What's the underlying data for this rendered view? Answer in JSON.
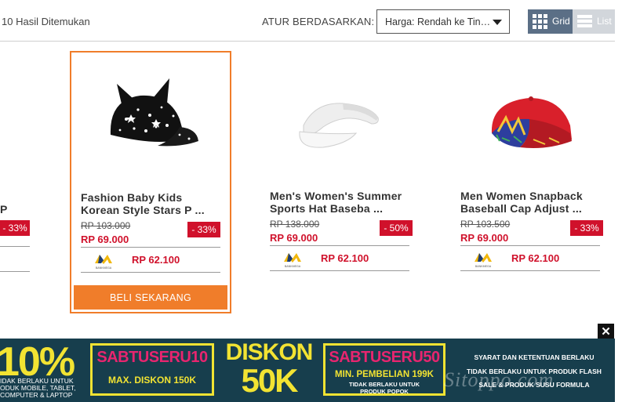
{
  "toolbar": {
    "results_text": "10 Hasil Ditemukan",
    "sort_label": "ATUR BERDASARKAN:",
    "sort_value": "Harga: Rendah ke Tin…",
    "grid_label": "Grid",
    "list_label": "List"
  },
  "partial_card": {
    "title": "P ...",
    "discount": "- 33%"
  },
  "products": [
    {
      "title_line1": "Fashion Baby Kids",
      "title_line2": "Korean Style Stars P ...",
      "old_price": "RP 103.000",
      "price": "RP 69.000",
      "discount": "- 33%",
      "bank_name": "BANKMEGA",
      "bank_price": "RP 62.100",
      "buy_label": "BELI SEKARANG"
    },
    {
      "title_line1": "Men's Women's Summer",
      "title_line2": "Sports Hat Baseba ...",
      "old_price": "RP 138.000",
      "price": "RP 69.000",
      "discount": "- 50%",
      "bank_name": "BANKMEGA",
      "bank_price": "RP 62.100"
    },
    {
      "title_line1": "Men Women Snapback",
      "title_line2": "Baseball Cap Adjust ...",
      "old_price": "RP 103.500",
      "price": "RP 69.000",
      "discount": "- 33%",
      "bank_name": "BANKMEGA",
      "bank_price": "RP 62.100"
    }
  ],
  "banner": {
    "percent": "10%",
    "percent_note_1": "IDAK BERLAKU UNTUK",
    "percent_note_2": "ODUK MOBILE, TABLET,",
    "percent_note_3": "COMPUTER & LAPTOP",
    "code1": "SABTUSERU10",
    "code1_sub": "MAX. DISKON 150K",
    "diskon": "DISKON",
    "diskon_amount": "50K",
    "code2": "SABTUSERU50",
    "code2_sub": "MIN. PEMBELIAN 199K",
    "code2_note_1": "TIDAK BERLAKU UNTUK",
    "code2_note_2": "PRODUK POPOK",
    "terms_1": "SYARAT DAN KETENTUAN BERLAKU",
    "terms_2": "TIDAK BERLAKU UNTUK PRODUK FLASH",
    "terms_3": "SALE & PRODUK SUSU FORMULA",
    "close": "✕",
    "watermark": "Sitoppo.com"
  },
  "colors": {
    "accent": "#f07d2a",
    "price_red": "#d0112b",
    "banner_bg": "#173e4d",
    "banner_yellow": "#f2e332",
    "banner_pink": "#e8256f"
  }
}
